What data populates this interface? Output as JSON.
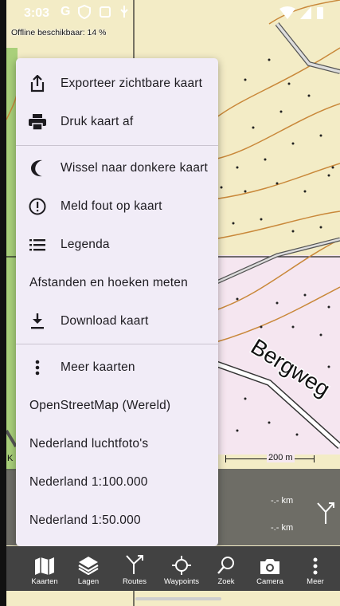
{
  "status_bar": {
    "time": "3:03"
  },
  "map": {
    "offline_text": "Offline beschikbaar: 14 %",
    "street_label": "Bergweg",
    "scale_label": "200 m",
    "edge_label": "K"
  },
  "menu": {
    "items": [
      {
        "label": "Exporteer zichtbare kaart",
        "icon": "share-export-icon"
      },
      {
        "label": "Druk kaart af",
        "icon": "printer-icon"
      },
      {
        "label": "Wissel naar donkere kaart",
        "icon": "moon-icon"
      },
      {
        "label": "Meld fout op kaart",
        "icon": "alert-circle-icon"
      },
      {
        "label": "Legenda",
        "icon": "list-icon"
      },
      {
        "label": "Afstanden en hoeken meten",
        "icon": ""
      },
      {
        "label": "Download kaart",
        "icon": "download-icon"
      },
      {
        "label": "Meer kaarten",
        "icon": "more-vertical-icon"
      },
      {
        "label": "OpenStreetMap (Wereld)",
        "icon": ""
      },
      {
        "label": "Nederland luchtfoto's",
        "icon": ""
      },
      {
        "label": "Nederland 1:100.000",
        "icon": ""
      },
      {
        "label": "Nederland 1:50.000",
        "icon": ""
      }
    ]
  },
  "info_panel": {
    "distance_1": "-.- km",
    "distance_2": "-.- km"
  },
  "bottom_nav": [
    {
      "label": "Kaarten",
      "icon": "map-icon"
    },
    {
      "label": "Lagen",
      "icon": "layers-icon"
    },
    {
      "label": "Routes",
      "icon": "route-icon"
    },
    {
      "label": "Waypoints",
      "icon": "crosshair-icon"
    },
    {
      "label": "Zoek",
      "icon": "search-icon"
    },
    {
      "label": "Camera",
      "icon": "camera-icon"
    },
    {
      "label": "Meer",
      "icon": "more-vertical-icon"
    }
  ],
  "colors": {
    "menu_bg": "#f1ecf7",
    "nav_bg": "#424242",
    "map_bg": "#f4eecc",
    "residential": "#f5e6f0"
  }
}
